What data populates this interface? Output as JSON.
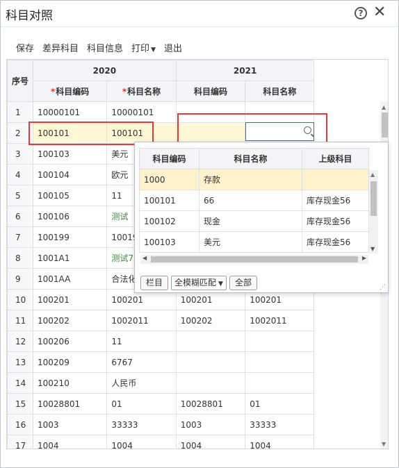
{
  "window": {
    "title": "科目对照"
  },
  "toolbar": {
    "save": "保存",
    "diff": "差异科目",
    "info": "科目信息",
    "print": "打印",
    "exit": "退出"
  },
  "grid": {
    "seq_header": "序号",
    "group_2020": "2020",
    "group_2021": "2021",
    "col_code": "科目编码",
    "col_name": "科目名称",
    "rows": [
      {
        "seq": "1",
        "c2020": "10000101",
        "n2020": "10000101",
        "c2021": "",
        "n2021": ""
      },
      {
        "seq": "2",
        "c2020": "100101",
        "n2020": "100101",
        "c2021": "",
        "n2021": ""
      },
      {
        "seq": "3",
        "c2020": "100103",
        "n2020": "美元",
        "c2021": "",
        "n2021": ""
      },
      {
        "seq": "4",
        "c2020": "100104",
        "n2020": "欧元",
        "c2021": "",
        "n2021": ""
      },
      {
        "seq": "5",
        "c2020": "100105",
        "n2020": "11",
        "c2021": "",
        "n2021": ""
      },
      {
        "seq": "6",
        "c2020": "100106",
        "n2020": "测试",
        "c2021": "",
        "n2021": ""
      },
      {
        "seq": "7",
        "c2020": "100199",
        "n2020": "10019",
        "c2021": "",
        "n2021": ""
      },
      {
        "seq": "8",
        "c2020": "1001A1",
        "n2020": "测试7",
        "c2021": "",
        "n2021": ""
      },
      {
        "seq": "9",
        "c2020": "1001AA",
        "n2020": "合法化",
        "c2021": "",
        "n2021": ""
      },
      {
        "seq": "10",
        "c2020": "100201",
        "n2020": "100201",
        "c2021": "100201",
        "n2021": "100201"
      },
      {
        "seq": "11",
        "c2020": "100202",
        "n2020": "1002011",
        "c2021": "100202",
        "n2021": "1002011"
      },
      {
        "seq": "12",
        "c2020": "100206",
        "n2020": "11",
        "c2021": "",
        "n2021": ""
      },
      {
        "seq": "13",
        "c2020": "100209",
        "n2020": "6767",
        "c2021": "",
        "n2021": ""
      },
      {
        "seq": "14",
        "c2020": "100210",
        "n2020": "人民币",
        "c2021": "",
        "n2021": ""
      },
      {
        "seq": "15",
        "c2020": "10028801",
        "n2020": "01",
        "c2021": "10028801",
        "n2021": "01"
      },
      {
        "seq": "16",
        "c2020": "1003",
        "n2020": "33333",
        "c2021": "1003",
        "n2021": "33333"
      },
      {
        "seq": "17",
        "c2020": "1004",
        "n2020": "1004",
        "c2021": "1004",
        "n2021": "1004"
      }
    ]
  },
  "dropdown": {
    "col_code": "科目编码",
    "col_name": "科目名称",
    "col_parent": "上级科目",
    "rows": [
      {
        "code": "1000",
        "name": "存款",
        "parent": ""
      },
      {
        "code": "100101",
        "name": "66",
        "parent": "库存现金56"
      },
      {
        "code": "100102",
        "name": "现金",
        "parent": "库存现金56"
      },
      {
        "code": "100103",
        "name": "美元",
        "parent": "库存现金56"
      }
    ],
    "btn_columns": "栏目",
    "match_mode": "全模糊匹配",
    "btn_all": "全部"
  },
  "colors": {
    "highlight_row": "#fff7d6",
    "red_box": "#e23a3a",
    "required": "#e0352b"
  }
}
